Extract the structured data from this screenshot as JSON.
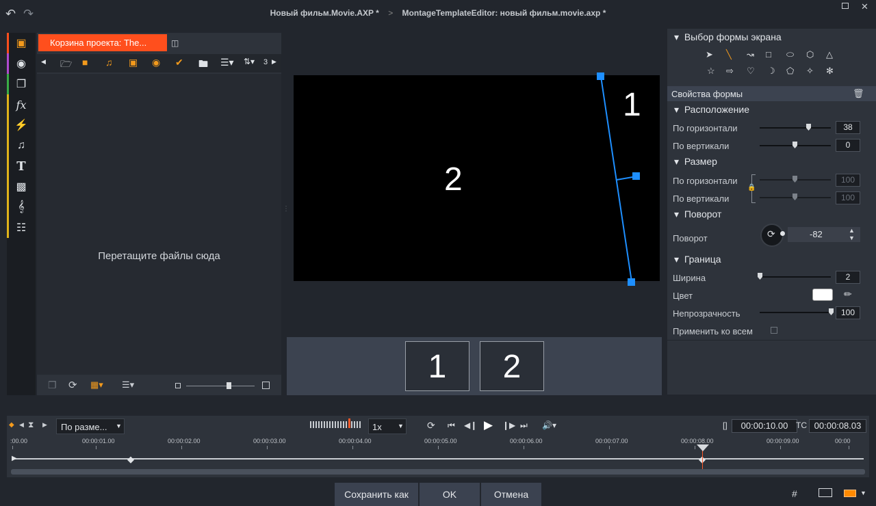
{
  "window": {
    "title_main": "Новый фильм.Movie.AXP",
    "title_editor": "MontageTemplateEditor: новый фильм.movie.axp",
    "modified_mark": "*",
    "breadcrumb_sep": ">"
  },
  "bin": {
    "tab_label": "Корзина проекта: The...",
    "drop_text": "Перетащите файлы сюда",
    "sort_count": "3"
  },
  "preview": {
    "label_1": "1",
    "label_2": "2"
  },
  "thumbs": [
    "1",
    "2"
  ],
  "shape_picker": {
    "title": "Выбор формы экрана",
    "icons_row1": [
      "arrow-cursor-icon",
      "line-icon",
      "polyline-icon",
      "rectangle-icon",
      "ellipse-icon",
      "hexagon-icon",
      "triangle-icon"
    ],
    "icons_row2": [
      "star-icon",
      "arrow-right-icon",
      "heart-icon",
      "crescent-icon",
      "pentagon-icon",
      "four-point-star-icon",
      "six-point-star-icon"
    ]
  },
  "props": {
    "title": "Свойства формы",
    "position_title": "Расположение",
    "pos_h_label": "По горизонтали",
    "pos_h_value": "38",
    "pos_v_label": "По вертикали",
    "pos_v_value": "0",
    "size_title": "Размер",
    "size_h_label": "По горизонтали",
    "size_h_value": "100",
    "size_v_label": "По вертикали",
    "size_v_value": "100",
    "rotation_title": "Поворот",
    "rotation_label": "Поворот",
    "rotation_value": "-82",
    "border_title": "Граница",
    "width_label": "Ширина",
    "width_value": "2",
    "color_label": "Цвет",
    "color_value": "#ffffff",
    "opacity_label": "Непрозрачность",
    "opacity_value": "100",
    "apply_all_label": "Применить ко всем",
    "slider_levels": {
      "pos_h": 0.69,
      "pos_v": 0.5,
      "size_h": 0.5,
      "size_v": 0.5,
      "width": 0.02,
      "opacity": 1.0
    }
  },
  "timeline": {
    "fit_select": "По разме...",
    "speed": "1x",
    "duration": "00:00:10.00",
    "tc_label": "TC",
    "timecode": "00:00:08.03",
    "in_out_icon": "[]",
    "ticks": [
      ":00.00",
      "00:00:01.00",
      "00:00:02.00",
      "00:00:03.00",
      "00:00:04.00",
      "00:00:05.00",
      "00:00:06.00",
      "00:00:07.00",
      "00:00:08.00",
      "00:00:09.00",
      "00:00"
    ],
    "playhead_time": "00:00:08.03",
    "keyframes": [
      "00:00:00.00",
      "00:00:01.40",
      "00:00:08.03"
    ]
  },
  "footer": {
    "save_as": "Сохранить как",
    "ok": "OK",
    "cancel": "Отмена"
  },
  "colors": {
    "accent": "#ff4f1d",
    "handle": "#1e8fff",
    "playhead": "#ff5a2a"
  }
}
